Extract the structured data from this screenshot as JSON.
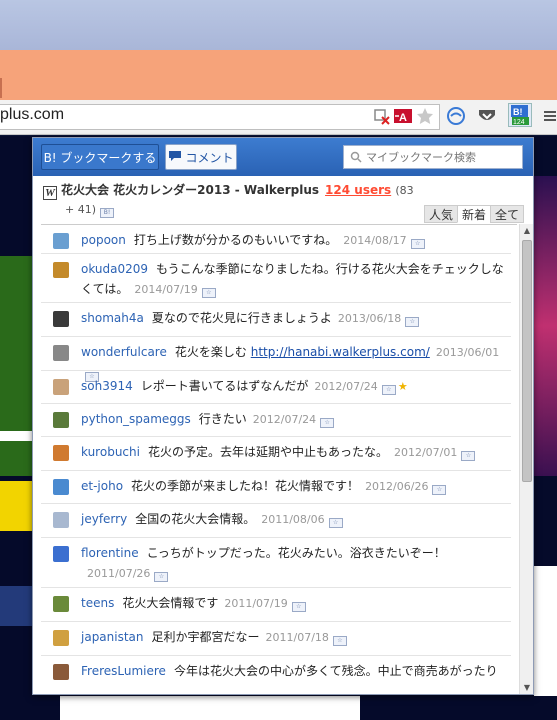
{
  "browser": {
    "url_text": "plus.com",
    "extension_badge": "124"
  },
  "popup": {
    "bookmark_button": "B! ブックマークする",
    "comment_button": "コメント",
    "search_placeholder": "マイブックマーク検索",
    "entry_title": "花火大会 花火カレンダー2013 - Walkerplus",
    "users_count": "124 users",
    "users_extra": "(83",
    "users_extra2": "+ 41)",
    "sort_tabs": [
      "人気",
      "新着",
      "全て"
    ],
    "active_sort": "新着"
  },
  "comments": [
    {
      "user": "popoon",
      "text": "打ち上げ数が分かるのもいいですね。",
      "date": "2014/08/17",
      "avatar_color": "#6a9fd1"
    },
    {
      "user": "okuda0209",
      "text": "もうこんな季節になりましたね。行ける花火大会をチェックしなくては。",
      "date": "2014/07/19",
      "avatar_color": "#c48a2a"
    },
    {
      "user": "shomah4a",
      "text": "夏なので花火見に行きましょうよ",
      "date": "2013/06/18",
      "avatar_color": "#3a3a3a"
    },
    {
      "user": "wonderfulcare",
      "text": "花火を楽しむ",
      "link": "http://hanabi.walkerplus.com/",
      "date": "2013/06/01",
      "avatar_color": "#888888"
    },
    {
      "user": "soh3914",
      "text": "レポート書いてるはずなんだが",
      "date": "2012/07/24",
      "avatar_color": "#c9a27a"
    },
    {
      "user": "python_spameggs",
      "text": "行きたい",
      "date": "2012/07/24",
      "avatar_color": "#5a7a3a"
    },
    {
      "user": "kurobuchi",
      "text": "花火の予定。去年は延期や中止もあったな。",
      "date": "2012/07/01",
      "avatar_color": "#d07a30"
    },
    {
      "user": "et-joho",
      "text": "花火の季節が来ましたね！花火情報です！",
      "date": "2012/06/26",
      "avatar_color": "#4a8ad0"
    },
    {
      "user": "jeyferry",
      "text": "全国の花火大会情報。",
      "date": "2011/08/06",
      "avatar_color": "#a8b8d0"
    },
    {
      "user": "florentine",
      "text": "こっちがトップだった。花火みたい。浴衣きたいぞー！",
      "date": "2011/07/26",
      "avatar_color": "#3b6fd0"
    },
    {
      "user": "teens",
      "text": "花火大会情報です",
      "date": "2011/07/19",
      "avatar_color": "#6a8a3a"
    },
    {
      "user": "japanistan",
      "text": "足利か宇都宮だなー",
      "date": "2011/07/18",
      "avatar_color": "#d0a040"
    },
    {
      "user": "FreresLumiere",
      "text": "今年は花火大会の中心が多くて残念。中止で商売あがったり",
      "date": "",
      "avatar_color": "#8a5a3a"
    }
  ]
}
